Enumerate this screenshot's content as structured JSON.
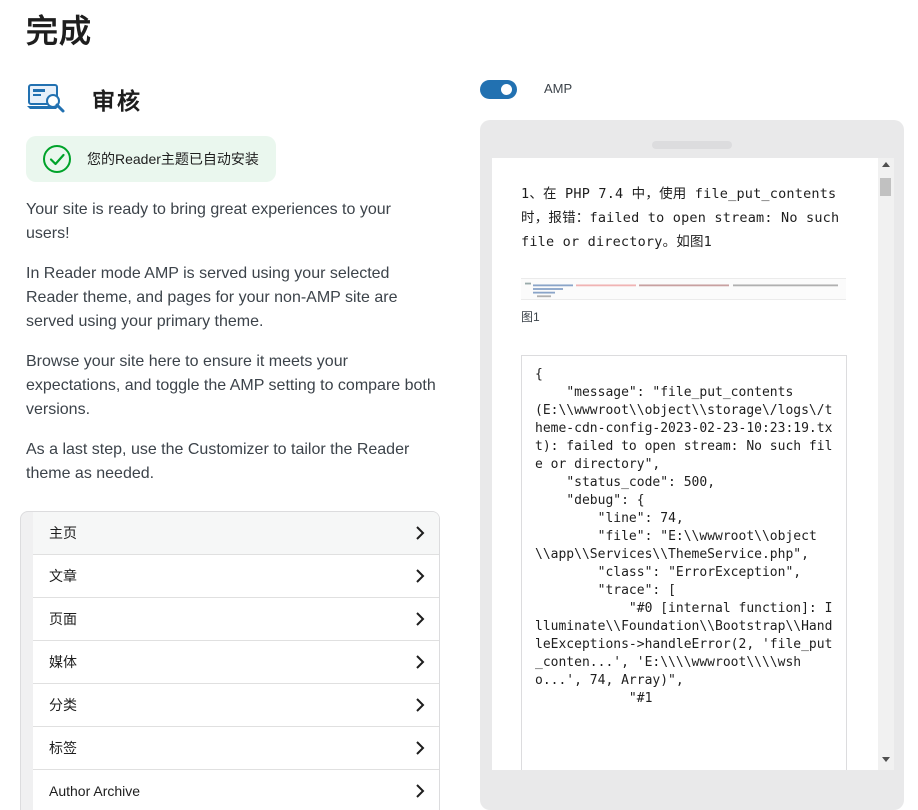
{
  "page": {
    "title": "完成"
  },
  "review": {
    "heading": "审核"
  },
  "notice": {
    "text": "您的Reader主题已自动安装"
  },
  "paragraphs": [
    "Your site is ready to bring great experiences to your users!",
    "In Reader mode AMP is served using your selected Reader theme, and pages for your non-AMP site are served using your primary theme.",
    "Browse your site here to ensure it meets your expectations, and toggle the AMP setting to compare both versions.",
    "As a last step, use the Customizer to tailor the Reader theme as needed."
  ],
  "nav": {
    "items": [
      "主页",
      "文章",
      "页面",
      "媒体",
      "分类",
      "标签",
      "Author Archive"
    ]
  },
  "toggle": {
    "label": "AMP",
    "checked": true
  },
  "preview": {
    "intro": "1、在 PHP 7.4 中，使用 file_put_contents 时，报错：failed to open stream: No such file or directory。如图1",
    "figure_caption": "图1",
    "code": "{\n    \"message\": \"file_put_contents(E:\\\\wwwroot\\\\object\\\\storage\\/logs\\/theme-cdn-config-2023-02-23-10:23:19.txt): failed to open stream: No such file or directory\",\n    \"status_code\": 500,\n    \"debug\": {\n        \"line\": 74,\n        \"file\": \"E:\\\\wwwroot\\\\object\\\\app\\\\Services\\\\ThemeService.php\",\n        \"class\": \"ErrorException\",\n        \"trace\": [\n            \"#0 [internal function]: Illuminate\\\\Foundation\\\\Bootstrap\\\\HandleExceptions->handleError(2, 'file_put_conten...', 'E:\\\\\\\\wwwroot\\\\\\\\wsho...', 74, Array)\",\n            \"#1"
  },
  "colors": {
    "accent": "#2271b1",
    "success": "#00a32a",
    "notice_bg": "#eaf7ee"
  }
}
